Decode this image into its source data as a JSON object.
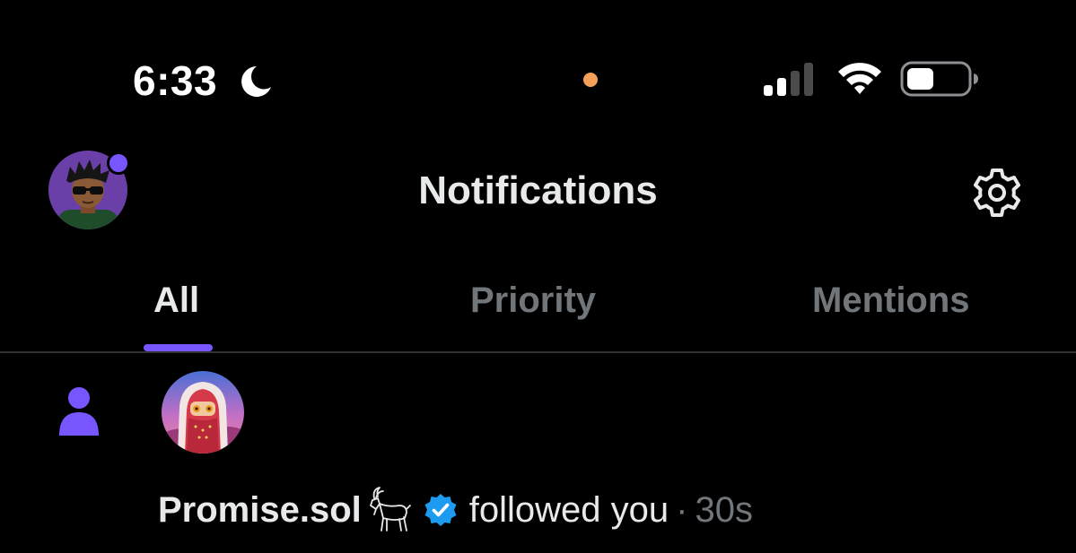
{
  "status_bar": {
    "time": "6:33",
    "focus_icon": "moon-icon",
    "privacy_dot_color": "#f5a05a",
    "signal_bars_active": 2,
    "signal_bars_total": 4,
    "battery_level": 0.45
  },
  "header": {
    "title": "Notifications",
    "profile_avatar": "profile-avatar",
    "settings_icon": "gear-icon",
    "unread_dot_color": "#7856ff"
  },
  "tabs": [
    {
      "label": "All",
      "active": true
    },
    {
      "label": "Priority",
      "active": false
    },
    {
      "label": "Mentions",
      "active": false
    }
  ],
  "accent_color": "#7856ff",
  "notifications": [
    {
      "type_icon": "person-icon",
      "user_name": "Promise.sol",
      "name_emoji": "goat-icon",
      "verified": true,
      "verified_color": "#1d9bf0",
      "action": "followed you",
      "separator": "·",
      "time": "30s"
    }
  ]
}
